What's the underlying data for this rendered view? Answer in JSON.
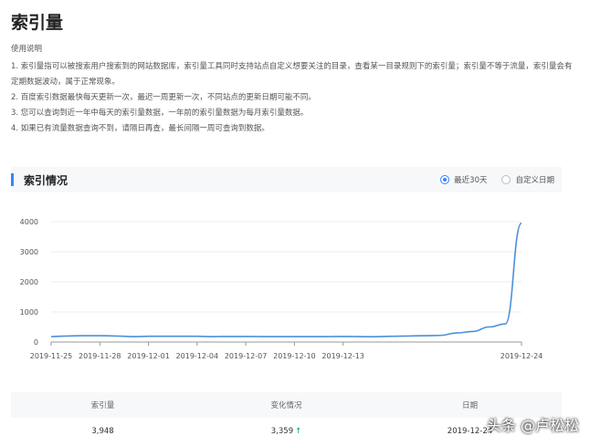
{
  "page": {
    "title": "索引量",
    "usage_heading": "使用说明",
    "usage_items": [
      "1. 索引量指可以被搜索用户搜索到的网站数据库，索引量工具同时支持站点自定义想要关注的目录，查看某一目录规则下的索引量；索引量不等于流量，索引量会有定期数据波动，属于正常现象。",
      "2. 百度索引数据最快每天更新一次，最迟一周更新一次，不同站点的更新日期可能不同。",
      "3. 您可以查询到近一年中每天的索引量数据，一年前的索引量数据为每月索引量数据。",
      "4. 如果已有流量数据查询不到，请隔日再查，最长间隔一周可查询到数据。"
    ]
  },
  "section": {
    "title": "索引情况",
    "range_options": [
      {
        "label": "最近30天",
        "checked": true
      },
      {
        "label": "自定义日期",
        "checked": false
      }
    ]
  },
  "chart_data": {
    "type": "line",
    "title": "",
    "xlabel": "",
    "ylabel": "",
    "ylim": [
      0,
      4000
    ],
    "yticks": [
      "0",
      "1000",
      "2000",
      "3000",
      "4000"
    ],
    "x_tick_labels": [
      "2019-11-25",
      "2019-11-28",
      "2019-12-01",
      "2019-12-04",
      "2019-12-07",
      "2019-12-10",
      "2019-12-13",
      "2019-12-24"
    ],
    "x": [
      "2019-11-25",
      "2019-11-26",
      "2019-11-27",
      "2019-11-28",
      "2019-11-29",
      "2019-11-30",
      "2019-12-01",
      "2019-12-02",
      "2019-12-03",
      "2019-12-04",
      "2019-12-05",
      "2019-12-06",
      "2019-12-07",
      "2019-12-08",
      "2019-12-09",
      "2019-12-10",
      "2019-12-11",
      "2019-12-12",
      "2019-12-13",
      "2019-12-14",
      "2019-12-15",
      "2019-12-16",
      "2019-12-17",
      "2019-12-18",
      "2019-12-19",
      "2019-12-20",
      "2019-12-21",
      "2019-12-22",
      "2019-12-23",
      "2019-12-24"
    ],
    "values": [
      180,
      200,
      210,
      210,
      200,
      180,
      190,
      190,
      190,
      190,
      180,
      185,
      185,
      180,
      180,
      180,
      180,
      180,
      185,
      180,
      175,
      190,
      200,
      210,
      220,
      300,
      350,
      500,
      600,
      3948
    ],
    "line_color": "#4a90d9",
    "grid": true
  },
  "table": {
    "headers": [
      "索引量",
      "变化情况",
      "日期"
    ],
    "row": {
      "count": "3,948",
      "change": "3,359",
      "change_arrow": "↑",
      "date": "2019-12-24"
    }
  },
  "watermark": "头条 @卢松松"
}
